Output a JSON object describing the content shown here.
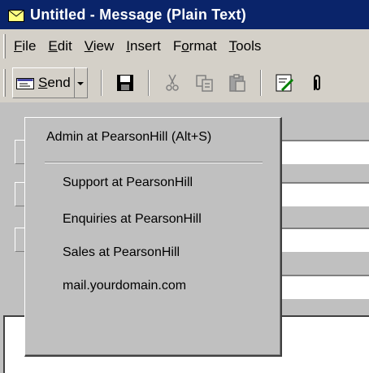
{
  "window": {
    "title": "Untitled - Message (Plain Text)"
  },
  "menubar": {
    "items": [
      {
        "pre": "",
        "key": "F",
        "post": "ile"
      },
      {
        "pre": "",
        "key": "E",
        "post": "dit"
      },
      {
        "pre": "",
        "key": "V",
        "post": "iew"
      },
      {
        "pre": "",
        "key": "I",
        "post": "nsert"
      },
      {
        "pre": "F",
        "key": "o",
        "post": "rmat"
      },
      {
        "pre": "",
        "key": "T",
        "post": "ools"
      }
    ]
  },
  "toolbar": {
    "send": {
      "pre": "",
      "key": "S",
      "post": "end"
    },
    "icons": [
      "save-icon",
      "cut-icon",
      "copy-icon",
      "paste-icon",
      "check-names-icon",
      "attach-icon"
    ]
  },
  "send_menu": {
    "default_account": "Admin at PearsonHill (Alt+S)",
    "accounts": [
      "Support at PearsonHill",
      "Enquiries at PearsonHill",
      "Sales at PearsonHill",
      "mail.yourdomain.com"
    ]
  },
  "colors": {
    "titlebar": "#0a246a",
    "face": "#d4d0c8",
    "menu_face": "#c0c0c0"
  }
}
